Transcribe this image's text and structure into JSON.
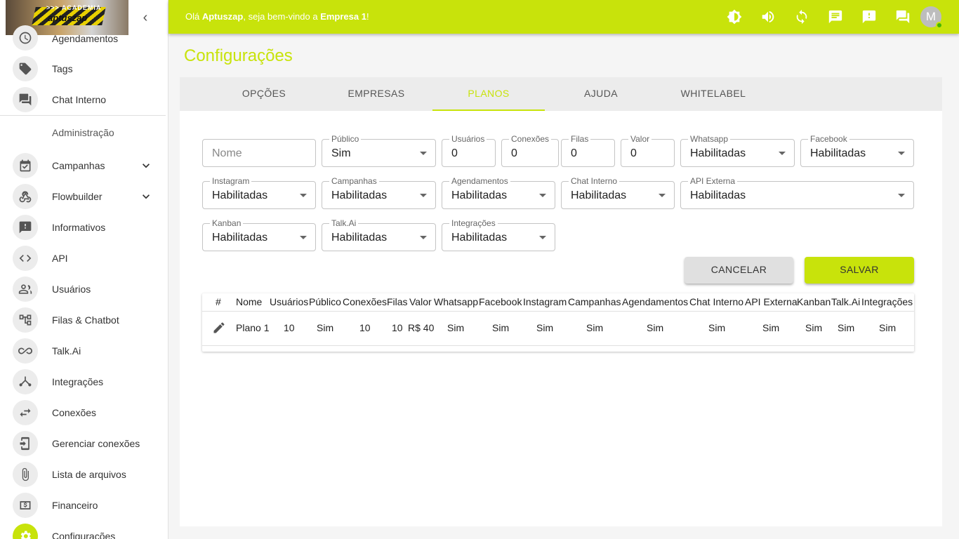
{
  "logo": {
    "text_top": ">>> ACADEMIA",
    "text_main": "aptuszap"
  },
  "sidebar": {
    "items_top": [
      {
        "label": "Agendamentos",
        "icon": "clock-icon"
      },
      {
        "label": "Tags",
        "icon": "tag-icon"
      },
      {
        "label": "Chat Interno",
        "icon": "chat-icon"
      }
    ],
    "section_label": "Administração",
    "items": [
      {
        "label": "Campanhas",
        "icon": "calendar-check-icon"
      },
      {
        "label": "Flowbuilder",
        "icon": "webhook-icon"
      },
      {
        "label": "Informativos",
        "icon": "announcement-icon"
      },
      {
        "label": "API",
        "icon": "code-icon"
      },
      {
        "label": "Usuários",
        "icon": "people-icon"
      },
      {
        "label": "Filas & Chatbot",
        "icon": "flow-tree-icon"
      },
      {
        "label": "Talk.Ai",
        "icon": "infinity-icon"
      },
      {
        "label": "Integrações",
        "icon": "merge-icon"
      },
      {
        "label": "Conexões",
        "icon": "swap-icon"
      },
      {
        "label": "Gerenciar conexões",
        "icon": "phone-settings-icon"
      },
      {
        "label": "Lista de arquivos",
        "icon": "paperclip-icon"
      },
      {
        "label": "Financeiro",
        "icon": "money-icon"
      },
      {
        "label": "Configurações",
        "icon": "gear-icon"
      }
    ]
  },
  "topbar": {
    "greet_prefix": "Olá ",
    "user": "Aptuszap",
    "greet_mid": ", seja bem-vindo a ",
    "company": "Empresa 1",
    "greet_suffix": "!",
    "avatar": "M"
  },
  "page": {
    "title": "Configurações"
  },
  "tabs": [
    "OPÇÕES",
    "EMPRESAS",
    "PLANOS",
    "AJUDA",
    "WHITELABEL"
  ],
  "form": {
    "nome_placeholder": "Nome",
    "publico": {
      "label": "Público",
      "value": "Sim"
    },
    "usuarios": {
      "label": "Usuários",
      "value": "0"
    },
    "conexoes": {
      "label": "Conexões",
      "value": "0"
    },
    "filas": {
      "label": "Filas",
      "value": "0"
    },
    "valor": {
      "label": "Valor",
      "value": "0"
    },
    "whatsapp": {
      "label": "Whatsapp",
      "value": "Habilitadas"
    },
    "facebook": {
      "label": "Facebook",
      "value": "Habilitadas"
    },
    "instagram": {
      "label": "Instagram",
      "value": "Habilitadas"
    },
    "campanhas": {
      "label": "Campanhas",
      "value": "Habilitadas"
    },
    "agendamentos": {
      "label": "Agendamentos",
      "value": "Habilitadas"
    },
    "chat_interno": {
      "label": "Chat Interno",
      "value": "Habilitadas"
    },
    "api_externa": {
      "label": "API Externa",
      "value": "Habilitadas"
    },
    "kanban": {
      "label": "Kanban",
      "value": "Habilitadas"
    },
    "talkai": {
      "label": "Talk.Ai",
      "value": "Habilitadas"
    },
    "integracoes": {
      "label": "Integrações",
      "value": "Habilitadas"
    },
    "cancel_label": "CANCELAR",
    "save_label": "SALVAR"
  },
  "table": {
    "headers": [
      "#",
      "Nome",
      "Usuários",
      "Público",
      "Conexões",
      "Filas",
      "Valor",
      "Whatsapp",
      "Facebook",
      "Instagram",
      "Campanhas",
      "Agendamentos",
      "Chat Interno",
      "API Externa",
      "Kanban",
      "Talk.Ai",
      "Integrações"
    ],
    "rows": [
      [
        "Plano 1",
        "10",
        "Sim",
        "10",
        "10",
        "R$ 40",
        "Sim",
        "Sim",
        "Sim",
        "Sim",
        "Sim",
        "Sim",
        "Sim",
        "Sim",
        "Sim",
        "Sim"
      ]
    ]
  },
  "colors": {
    "accent": "#c8e30b"
  }
}
